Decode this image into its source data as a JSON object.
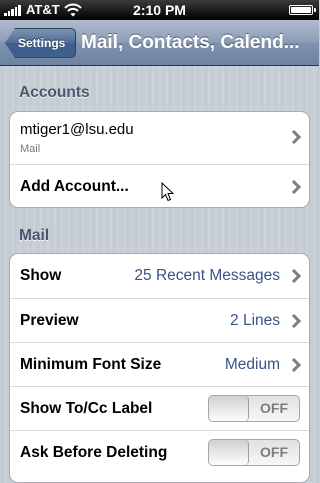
{
  "status_bar": {
    "carrier": "AT&T",
    "time": "2:10 PM",
    "icons": [
      "signal-icon",
      "wifi-icon",
      "battery-icon"
    ]
  },
  "nav_bar": {
    "back_label": "Settings",
    "title": "Mail, Contacts, Calend..."
  },
  "accounts": {
    "header": "Accounts",
    "items": [
      {
        "title": "mtiger1@lsu.edu",
        "subtitle": "Mail"
      },
      {
        "title": "Add Account..."
      }
    ]
  },
  "mail": {
    "header": "Mail",
    "items": [
      {
        "label": "Show",
        "value": "25 Recent Messages"
      },
      {
        "label": "Preview",
        "value": "2 Lines"
      },
      {
        "label": "Minimum Font Size",
        "value": "Medium"
      },
      {
        "label": "Show To/Cc Label",
        "toggle": "OFF"
      },
      {
        "label": "Ask Before Deleting",
        "toggle": "OFF"
      }
    ]
  },
  "colors": {
    "nav_bar": "#6d84a2",
    "value_text": "#385487",
    "section_header": "#4c566c"
  }
}
